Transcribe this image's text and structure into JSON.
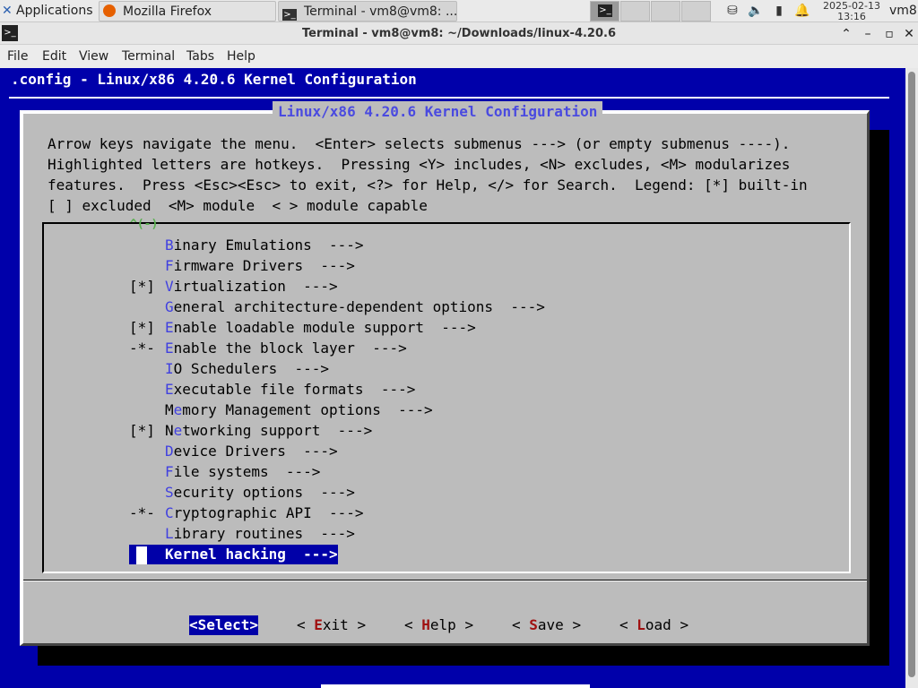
{
  "panel": {
    "applications": "Applications",
    "tasks": [
      {
        "label": "Mozilla Firefox"
      },
      {
        "label": "Terminal - vm8@vm8: ..."
      }
    ],
    "clock_date": "2025-02-13",
    "clock_time": "13:16",
    "user": "vm8"
  },
  "window": {
    "title": "Terminal - vm8@vm8: ~/Downloads/linux-4.20.6"
  },
  "menubar": [
    "File",
    "Edit",
    "View",
    "Terminal",
    "Tabs",
    "Help"
  ],
  "terminal": {
    "config_title": ".config - Linux/x86 4.20.6 Kernel Configuration",
    "dialog_title": "Linux/x86 4.20.6 Kernel Configuration",
    "help_lines": [
      "Arrow keys navigate the menu.  <Enter> selects submenus ---> (or empty submenus ----).",
      "Highlighted letters are hotkeys.  Pressing <Y> includes, <N> excludes, <M> modularizes",
      "features.  Press <Esc><Esc> to exit, <?> for Help, </> for Search.  Legend: [*] built-in",
      "[ ] excluded  <M> module  < > module capable"
    ],
    "scroll_indicator": "^(-)",
    "menu_items": [
      {
        "prefix": "",
        "hotkey": "B",
        "rest": "inary Emulations  --->"
      },
      {
        "prefix": "",
        "hotkey": "F",
        "rest": "irmware Drivers  --->"
      },
      {
        "prefix": "[*]",
        "hotkey": "V",
        "rest": "irtualization  --->"
      },
      {
        "prefix": "",
        "hotkey": "G",
        "rest": "eneral architecture-dependent options  --->"
      },
      {
        "prefix": "[*]",
        "hotkey": "E",
        "rest": "nable loadable module support  --->"
      },
      {
        "prefix": "-*-",
        "hotkey": "E",
        "rest": "nable the block layer  --->"
      },
      {
        "prefix": "",
        "hotkey": "I",
        "rest": "O Schedulers  --->"
      },
      {
        "prefix": "",
        "hotkey": "E",
        "rest": "xecutable file formats  --->"
      },
      {
        "prefix": "",
        "pre": "M",
        "hotkey": "e",
        "rest": "mory Management options  --->"
      },
      {
        "prefix": "[*]",
        "pre": "N",
        "hotkey": "e",
        "rest": "tworking support  --->"
      },
      {
        "prefix": "",
        "hotkey": "D",
        "rest": "evice Drivers  --->"
      },
      {
        "prefix": "",
        "hotkey": "F",
        "rest": "ile systems  --->"
      },
      {
        "prefix": "",
        "hotkey": "S",
        "rest": "ecurity options  --->"
      },
      {
        "prefix": "-*-",
        "hotkey": "C",
        "rest": "ryptographic API  --->"
      },
      {
        "prefix": "",
        "hotkey": "L",
        "rest": "ibrary routines  --->"
      },
      {
        "prefix": "",
        "hotkey": "K",
        "rest": "ernel hacking  --->",
        "selected": true
      }
    ],
    "buttons": [
      {
        "text": "<Select>",
        "selected": true
      },
      {
        "pre": "< ",
        "hotkey": "E",
        "rest": "xit >"
      },
      {
        "pre": "< ",
        "hotkey": "H",
        "rest": "elp >"
      },
      {
        "pre": "< ",
        "hotkey": "S",
        "rest": "ave >"
      },
      {
        "pre": "< ",
        "hotkey": "L",
        "rest": "oad >"
      }
    ]
  },
  "colors": {
    "terminal_bg": "#0000aa",
    "dialog_bg": "#bcbcbc",
    "dialog_title": "#4a4ae0",
    "hotkey": "#4040e0",
    "button_hotkey": "#a01010",
    "selection_bg": "#0000a8"
  },
  "icons": [
    "xfce-logo-icon",
    "firefox-icon",
    "terminal-icon",
    "network-icon",
    "volume-icon",
    "battery-icon",
    "notification-bell-icon"
  ]
}
